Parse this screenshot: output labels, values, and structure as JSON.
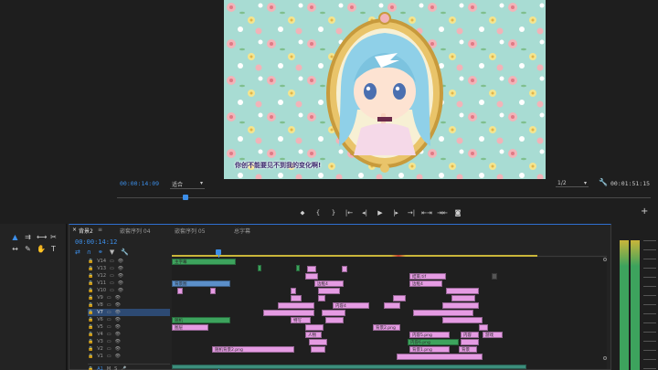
{
  "monitor": {
    "timecode_current": "00:00:14:09",
    "fit_option": "适合",
    "quality": "1/2",
    "timecode_total": "00:01:51:15",
    "subtitle": "你创不能要见不到我的变化啊!",
    "controls": [
      "⬥",
      "{",
      "}",
      "|←",
      "◂|",
      "▶",
      "|▸",
      "→|",
      "⇤⇥",
      "⇥⇤",
      "◙"
    ]
  },
  "timeline": {
    "tabs": [
      "背景2",
      "嵌套序列 04",
      "嵌套序列 05",
      "总字幕"
    ],
    "active_tab": 0,
    "timecode": "00:00:14:12",
    "tracks": [
      "V14",
      "V13",
      "V12",
      "V11",
      "V10",
      "V9",
      "V8",
      "V7",
      "V6",
      "V5",
      "V4",
      "V3",
      "V2",
      "V1"
    ],
    "audio_tracks": [
      "A1"
    ],
    "clip_labels": {
      "title_clip": "主字幕",
      "bg_clip": "背景图",
      "clip_a": "随机",
      "clip_b": "随机背景2.png",
      "clip_c": "随机背景1.png",
      "clip_d": "结束.tif",
      "clip_e": "边框4",
      "clip_f": "内容4",
      "clip_g": "特写",
      "clip_h": "人物",
      "clip_i": "背景2.png",
      "clip_j": "内容5.png",
      "clip_k": "内容",
      "clip_l": "游戏",
      "clip_m": "背景1.png",
      "clip_n": "内容6.png",
      "clip_o": "背景",
      "clip_p": "图层"
    }
  },
  "colors": {
    "accent": "#2f6fd1",
    "timecode": "#3c8ee8",
    "clip_pink": "#e59be3",
    "clip_green": "#3da35d"
  }
}
